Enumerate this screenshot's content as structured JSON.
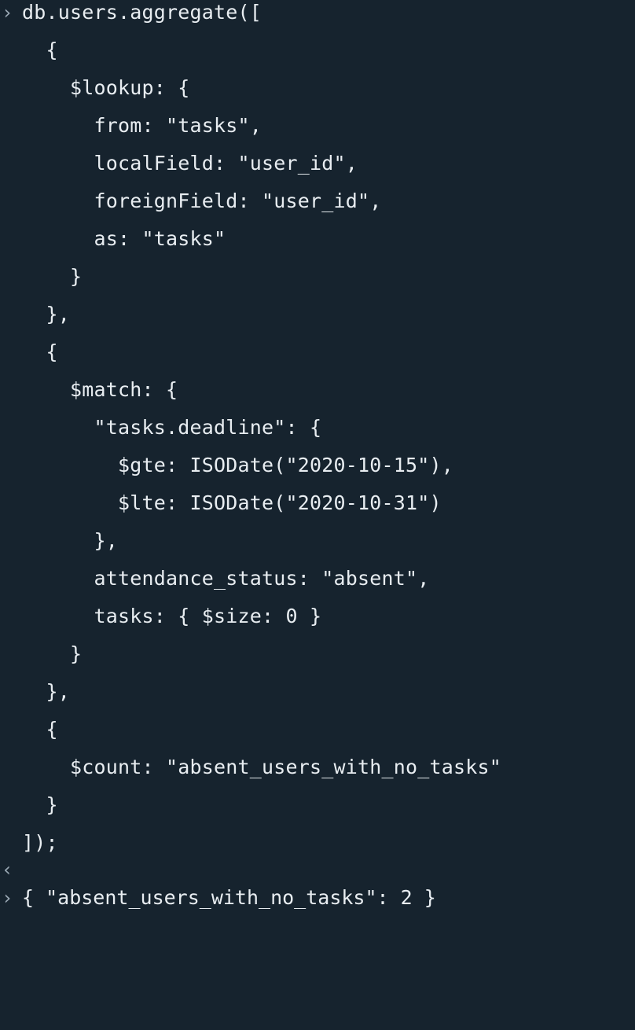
{
  "console": {
    "prompt_icon": "chevron-right-icon",
    "return_icon": "chevron-left-icon",
    "lines": [
      "db.users.aggregate([",
      "  {",
      "    $lookup: {",
      "      from: \"tasks\",",
      "      localField: \"user_id\",",
      "      foreignField: \"user_id\",",
      "      as: \"tasks\"",
      "    }",
      "  },",
      "  {",
      "    $match: {",
      "      \"tasks.deadline\": {",
      "        $gte: ISODate(\"2020-10-15\"),",
      "        $lte: ISODate(\"2020-10-31\")",
      "      },",
      "      attendance_status: \"absent\",",
      "      tasks: { $size: 0 }",
      "    }",
      "  },",
      "  {",
      "    $count: \"absent_users_with_no_tasks\"",
      "  }",
      "]);"
    ],
    "result": "{ \"absent_users_with_no_tasks\": 2 }"
  }
}
